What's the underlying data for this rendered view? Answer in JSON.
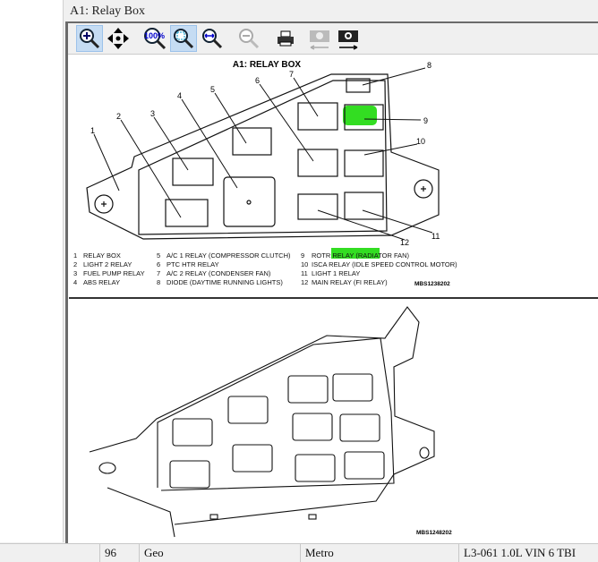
{
  "window": {
    "title": "A1: Relay Box"
  },
  "toolbar": {
    "buttons": [
      {
        "name": "zoom-in",
        "icon": "zoom-in-icon",
        "active": true
      },
      {
        "name": "pan",
        "icon": "move-arrows-icon",
        "active": false
      },
      {
        "name": "zoom-100",
        "icon": "zoom-100-icon",
        "label": "100%",
        "active": false
      },
      {
        "name": "zoom-fit",
        "icon": "zoom-fit-icon",
        "active": true
      },
      {
        "name": "zoom-width",
        "icon": "zoom-width-icon",
        "active": false
      },
      {
        "name": "zoom-out",
        "icon": "zoom-out-icon",
        "active": false,
        "disabled": true
      },
      {
        "name": "print",
        "icon": "printer-icon",
        "active": false
      },
      {
        "name": "previous-image",
        "icon": "camera-back-icon",
        "disabled": true
      },
      {
        "name": "next-image",
        "icon": "camera-forward-icon",
        "disabled": false
      }
    ]
  },
  "diagram": {
    "title": "A1: RELAY BOX",
    "highlight_color": "#33dd22",
    "callouts": [
      "1",
      "2",
      "3",
      "4",
      "5",
      "6",
      "7",
      "8",
      "9",
      "10",
      "11",
      "12"
    ],
    "legend": [
      [
        "1",
        "RELAY BOX"
      ],
      [
        "2",
        "LIGHT 2 RELAY"
      ],
      [
        "3",
        "FUEL PUMP RELAY"
      ],
      [
        "4",
        "ABS RELAY"
      ],
      [
        "5",
        "A/C 1 RELAY (COMPRESSOR CLUTCH)"
      ],
      [
        "6",
        "PTC HTR RELAY"
      ],
      [
        "7",
        "A/C 2 RELAY (CONDENSER FAN)"
      ],
      [
        "8",
        "DIODE (DAYTIME RUNNING LIGHTS)"
      ],
      [
        "9",
        "ROTR RELAY (RADIATOR FAN)"
      ],
      [
        "10",
        "ISCA RELAY (IDLE SPEED CONTROL MOTOR)"
      ],
      [
        "11",
        "LIGHT 1 RELAY"
      ],
      [
        "12",
        "MAIN RELAY (FI RELAY)"
      ]
    ],
    "code_top": "MBS1238202",
    "code_bottom": "MBS1248202"
  },
  "status": {
    "year": "96",
    "make": "Geo",
    "model": "Metro",
    "engine": "L3-061 1.0L VIN 6 TBI"
  }
}
